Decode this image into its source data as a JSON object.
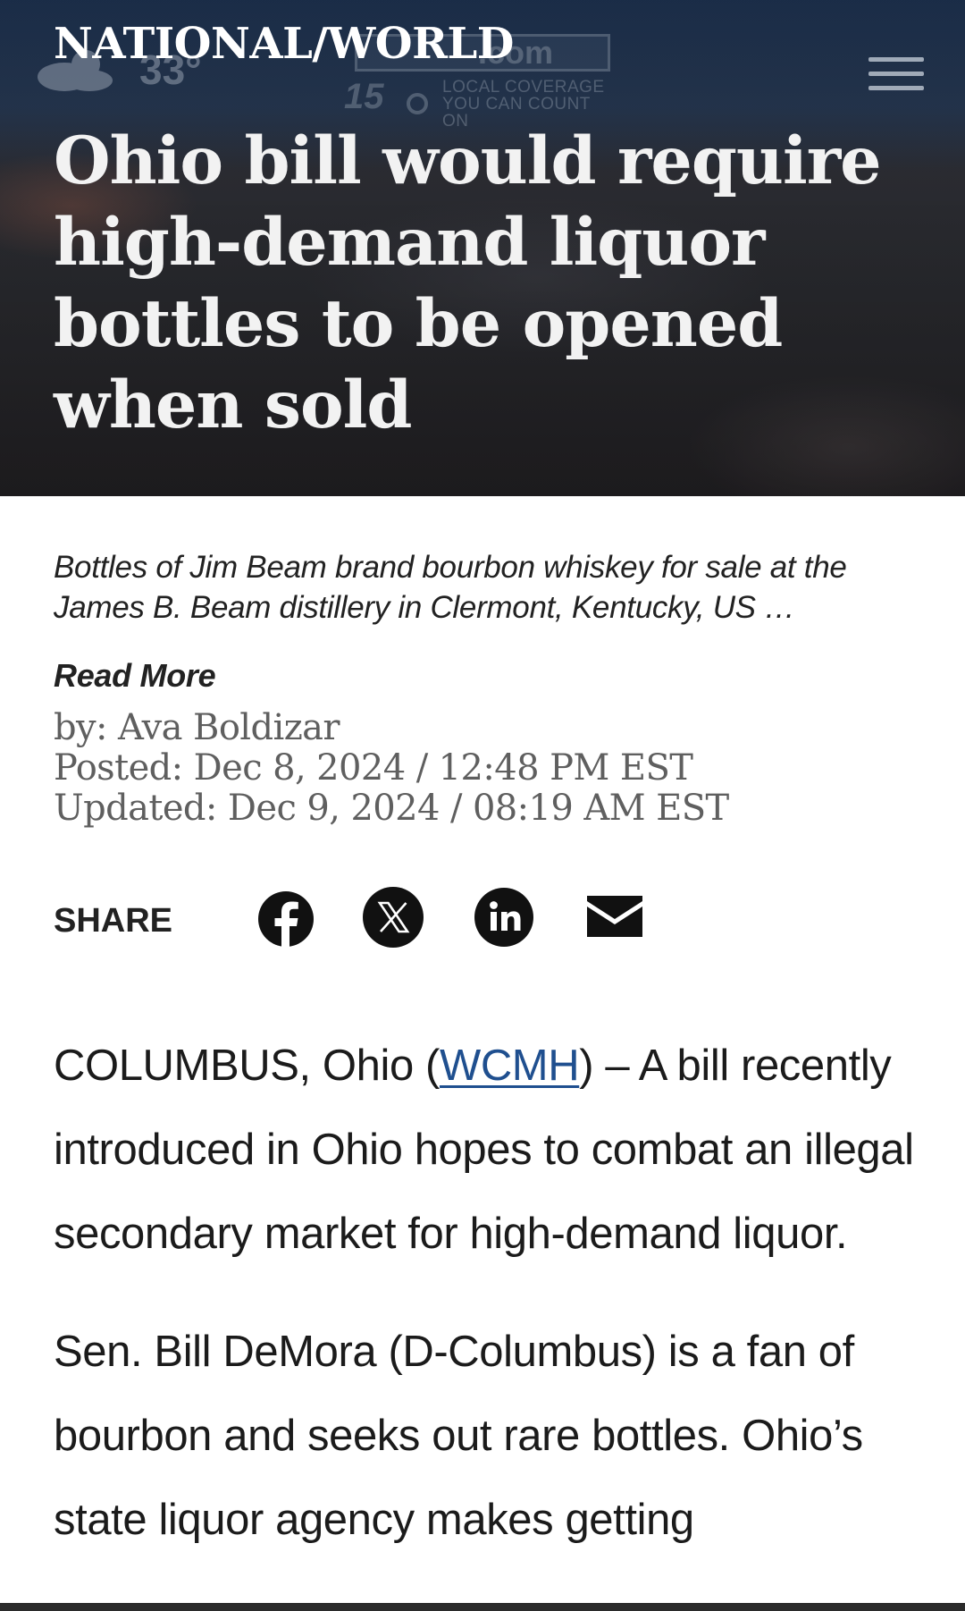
{
  "header": {
    "weather": {
      "icon": "partly-cloudy-icon",
      "temperature": "33°"
    },
    "logo": {
      "dotcom": ".com",
      "channel": "15",
      "tagline_line1": "LOCAL COVERAGE",
      "tagline_line2": "YOU CAN COUNT ON"
    },
    "menu_icon": "hamburger-menu-icon"
  },
  "article": {
    "section": "NATIONAL/WORLD",
    "headline": "Ohio bill would require high-demand liquor bottles to be opened when sold",
    "caption": "Bottles of Jim Beam brand bourbon whiskey for sale at the James B. Beam distillery in Clermont, Kentucky, US …",
    "read_more": "Read More",
    "byline": "by: Ava Boldizar",
    "posted": "Posted: Dec 8, 2024 / 12:48 PM EST",
    "updated": "Updated: Dec 9, 2024 / 08:19 AM EST",
    "share": {
      "label": "SHARE",
      "icons": [
        "facebook-icon",
        "x-twitter-icon",
        "linkedin-icon",
        "email-icon"
      ]
    },
    "body": {
      "p1_prefix": "COLUMBUS, Ohio (",
      "p1_link": "WCMH",
      "p1_suffix": ") – A bill recently introduced in Ohio hopes to combat an illegal secondary market for high-demand liquor.",
      "p2": "Sen. Bill DeMora (D-Columbus) is a fan of bourbon and seeks out rare bottles. Ohio’s state liquor agency makes getting"
    }
  },
  "colors": {
    "header_top": "#1e2f48",
    "headline_text": "#f2f2f2",
    "byline_text": "#5f5f5f",
    "link": "#1f4f8f",
    "body_text": "#1b1b1b"
  }
}
